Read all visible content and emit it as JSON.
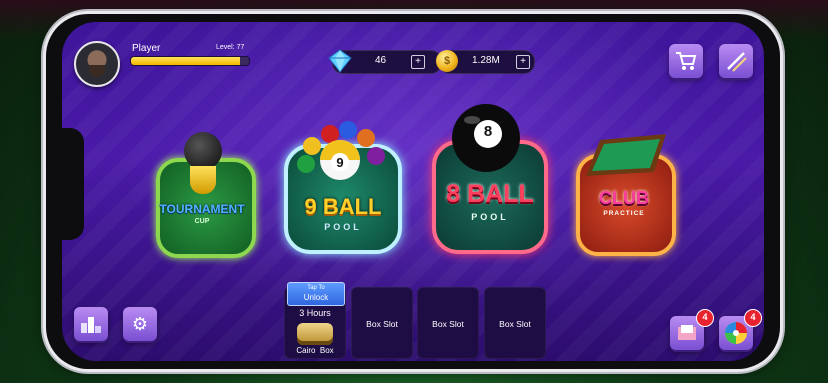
{
  "player": {
    "name": "Player",
    "level_text": "Level: 77",
    "xp_progress": 0.92
  },
  "currency": {
    "gems": "46",
    "coins": "1.28M",
    "coin_symbol": "$"
  },
  "modes": {
    "tournament": {
      "title": "TOURNAMENT",
      "subtitle": "CUP"
    },
    "nine_ball": {
      "title": "9 BALL",
      "subtitle": "POOL",
      "ball_number": "9"
    },
    "eight_ball": {
      "title": "8 BALL",
      "subtitle": "POOL",
      "ball_number": "8"
    },
    "club": {
      "title": "CLUB",
      "subtitle": "PRACTICE"
    }
  },
  "boxes": {
    "unlock_line1": "Tap To",
    "unlock_line2": "Unlock",
    "duration": "3 Hours",
    "box_name": "Cairo  Box",
    "empty_slots": [
      "Box Slot",
      "Box Slot",
      "Box Slot"
    ]
  },
  "badges": {
    "inbox_count": "4",
    "wheel_count": "4"
  },
  "icons": {
    "shop": "cart-icon",
    "cues": "cue-icon",
    "leaderboard": "podium-icon",
    "settings": "gear-icon",
    "inbox": "inbox-icon",
    "wheel": "spin-wheel-icon"
  },
  "colors": {
    "background": "#3e159a",
    "xp_fill": "#f3b800",
    "badge": "#e8222e",
    "unlock_button": "#3a7ef5"
  }
}
